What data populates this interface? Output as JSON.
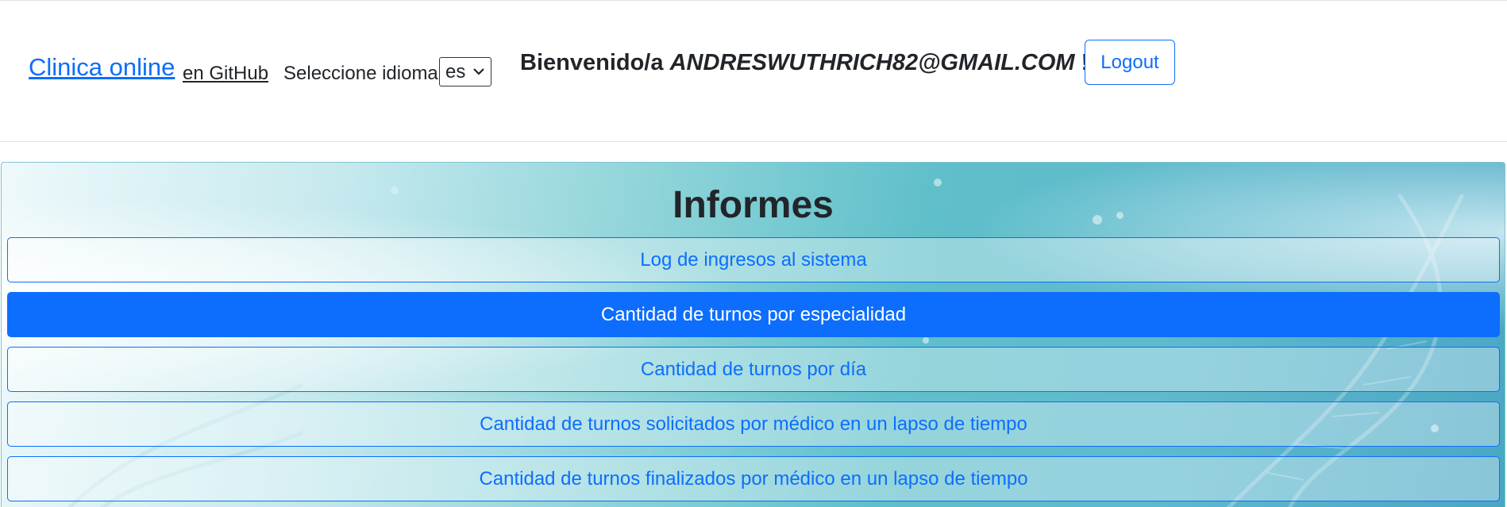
{
  "header": {
    "brand": "Clinica online",
    "github_link": "en GitHub",
    "language_label": "Seleccione idioma",
    "language_selected": "es",
    "welcome_prefix": "Bienvenido/a",
    "welcome_user": "ANDRESWUTHRICH82@GMAIL.COM",
    "welcome_suffix": "!!",
    "logout_label": "Logout"
  },
  "reports": {
    "title": "Informes",
    "items": [
      {
        "label": "Log de ingresos al sistema",
        "active": false
      },
      {
        "label": "Cantidad de turnos por especialidad",
        "active": true
      },
      {
        "label": "Cantidad de turnos por día",
        "active": false
      },
      {
        "label": "Cantidad de turnos solicitados por médico en un lapso de tiempo",
        "active": false
      },
      {
        "label": "Cantidad de turnos finalizados por médico en un lapso de tiempo",
        "active": false
      }
    ]
  },
  "colors": {
    "primary": "#0d6efd",
    "text": "#212529",
    "panel_teal": "#5fbfca"
  },
  "icons": {
    "select_arrow": "chevron-down-icon"
  }
}
